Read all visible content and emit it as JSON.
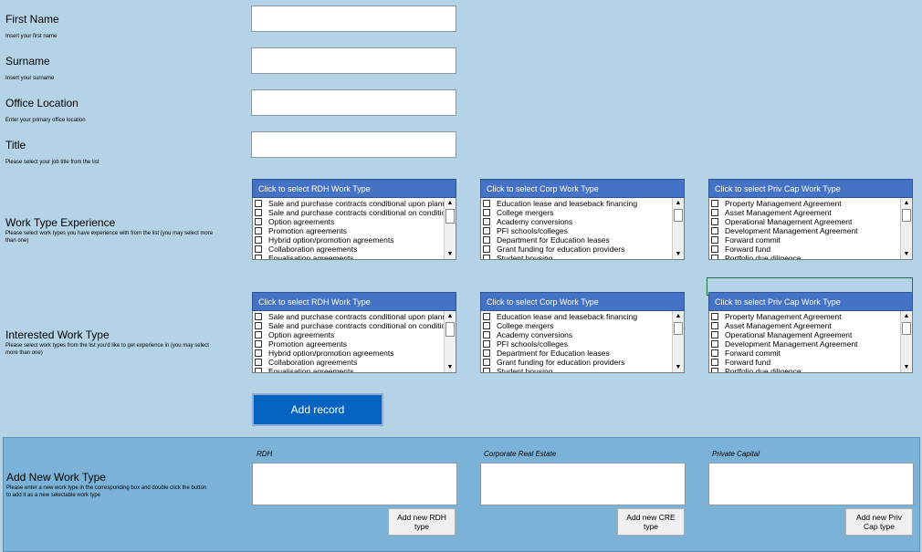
{
  "form": {
    "first_name": {
      "label": "First Name",
      "hint": "Insert your first name"
    },
    "surname": {
      "label": "Surname",
      "hint": "Insert your surname"
    },
    "office": {
      "label": "Office Location",
      "hint": "Enter your primary office location"
    },
    "title": {
      "label": "Title",
      "hint": "Please select your job title from the list"
    },
    "experience": {
      "label": "Work Type Experience",
      "hint": "Please select work types you have experience with from the list (you may select more than one)"
    },
    "interested": {
      "label": "Interested Work Type",
      "hint": "Please select work types from the list you'd like to get experience in (you may select more than one)"
    },
    "add_new": {
      "label": "Add New Work Type",
      "hint": "Please enter a new work type in the corresponding box and double click the button to add it as a new selectable work type"
    }
  },
  "lists": {
    "rdh": {
      "header": "Click to select RDH Work Type",
      "items": [
        "Sale and purchase contracts conditional upon planning",
        "Sale and purchase contracts conditional on condition",
        "Option agreements",
        "Promotion agreements",
        "Hybrid option/promotion agreements",
        "Collaboration agreements",
        "Equalisation agreements"
      ]
    },
    "corp": {
      "header": "Click to select Corp Work Type",
      "items": [
        "Education lease and leaseback financing",
        "College mergers",
        "Academy conversions",
        "PFI schools/colleges",
        "Department for Education leases",
        "Grant funding for education providers",
        "Student housing"
      ]
    },
    "priv": {
      "header": "Click to select Priv Cap Work Type",
      "items": [
        "Property Management Agreement",
        "Asset Management Agreement",
        "Operational Management Agreement",
        "Development Management Agreement",
        "Forward commit",
        "Forward fund",
        "Portfolio due diligence"
      ]
    }
  },
  "add_record_label": "Add record",
  "new_type": {
    "rdh_title": "RDH",
    "cre_title": "Corporate Real Estate",
    "priv_title": "Private Capital",
    "rdh_button": "Add new RDH type",
    "cre_button": "Add new CRE type",
    "priv_button": "Add new Priv Cap type"
  },
  "colors": {
    "background": "#b4d3e6",
    "list_header": "#4472c4",
    "button": "#0563c1",
    "panel": "#7bb3d8"
  }
}
